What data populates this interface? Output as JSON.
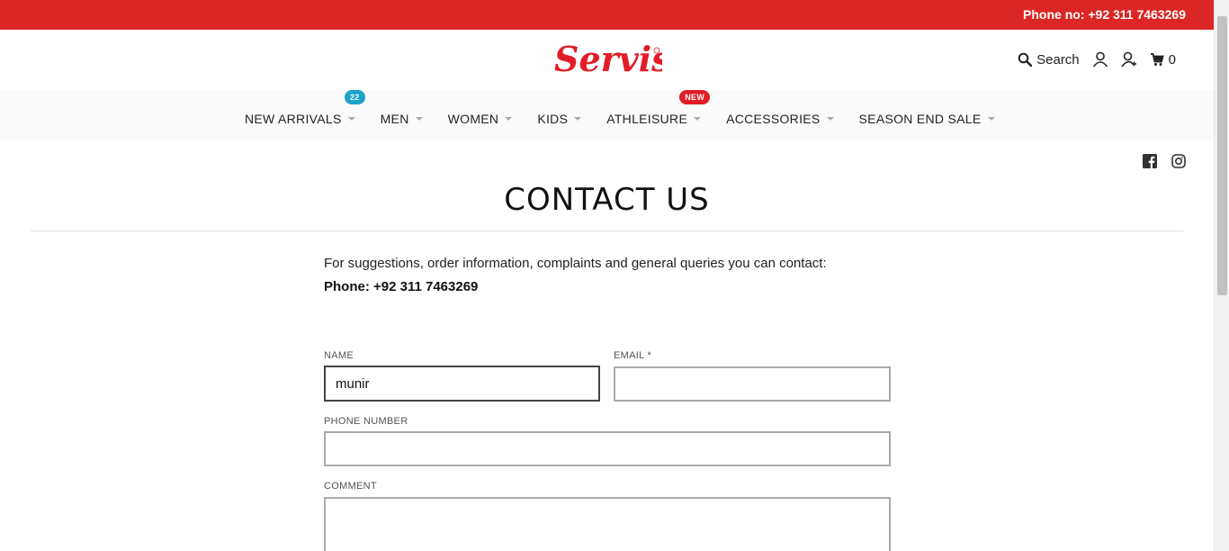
{
  "topbar": {
    "phone_text": "Phone no: +92 311 7463269"
  },
  "header": {
    "logo_text": "Servis",
    "search_label": "Search",
    "cart_count": "0"
  },
  "nav": {
    "items": [
      {
        "label": "NEW ARRIVALS",
        "badge": "22"
      },
      {
        "label": "MEN"
      },
      {
        "label": "WOMEN"
      },
      {
        "label": "KIDS"
      },
      {
        "label": "ATHLEISURE",
        "badge": "NEW"
      },
      {
        "label": "ACCESSORIES"
      },
      {
        "label": "SEASON END SALE"
      }
    ]
  },
  "social": {
    "icons": [
      "facebook-icon",
      "instagram-icon"
    ]
  },
  "page": {
    "title": "CONTACT US",
    "intro": "For suggestions, order information, complaints and general queries you can contact:",
    "phone_line": "Phone: +92 311 7463269"
  },
  "form": {
    "name_label": "NAME",
    "name_value": "munir",
    "email_label": "EMAIL *",
    "email_value": "",
    "phone_label": "PHONE NUMBER",
    "phone_value": "",
    "comment_label": "COMMENT",
    "comment_value": ""
  },
  "colors": {
    "brand_red": "#dc2626",
    "badge_teal": "#1aa3c7"
  }
}
